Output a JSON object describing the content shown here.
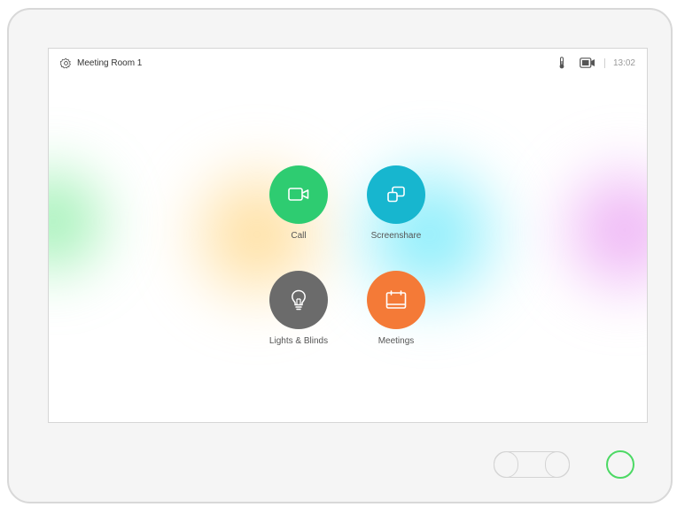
{
  "header": {
    "room_name": "Meeting Room 1",
    "icons": [
      "gear-icon",
      "thermometer-icon",
      "camera-icon"
    ],
    "time": "13:02"
  },
  "tiles": [
    {
      "label": "Call",
      "icon": "video-camera-icon",
      "color": "#2ecc71"
    },
    {
      "label": "Screenshare",
      "icon": "screenshare-icon",
      "color": "#17b6cf"
    },
    {
      "label": "Lights & Blinds",
      "icon": "lightbulb-icon",
      "color": "#6b6b6b"
    },
    {
      "label": "Meetings",
      "icon": "calendar-icon",
      "color": "#f47a37"
    }
  ],
  "hardware": {
    "power_button_color": "#4cd964"
  }
}
